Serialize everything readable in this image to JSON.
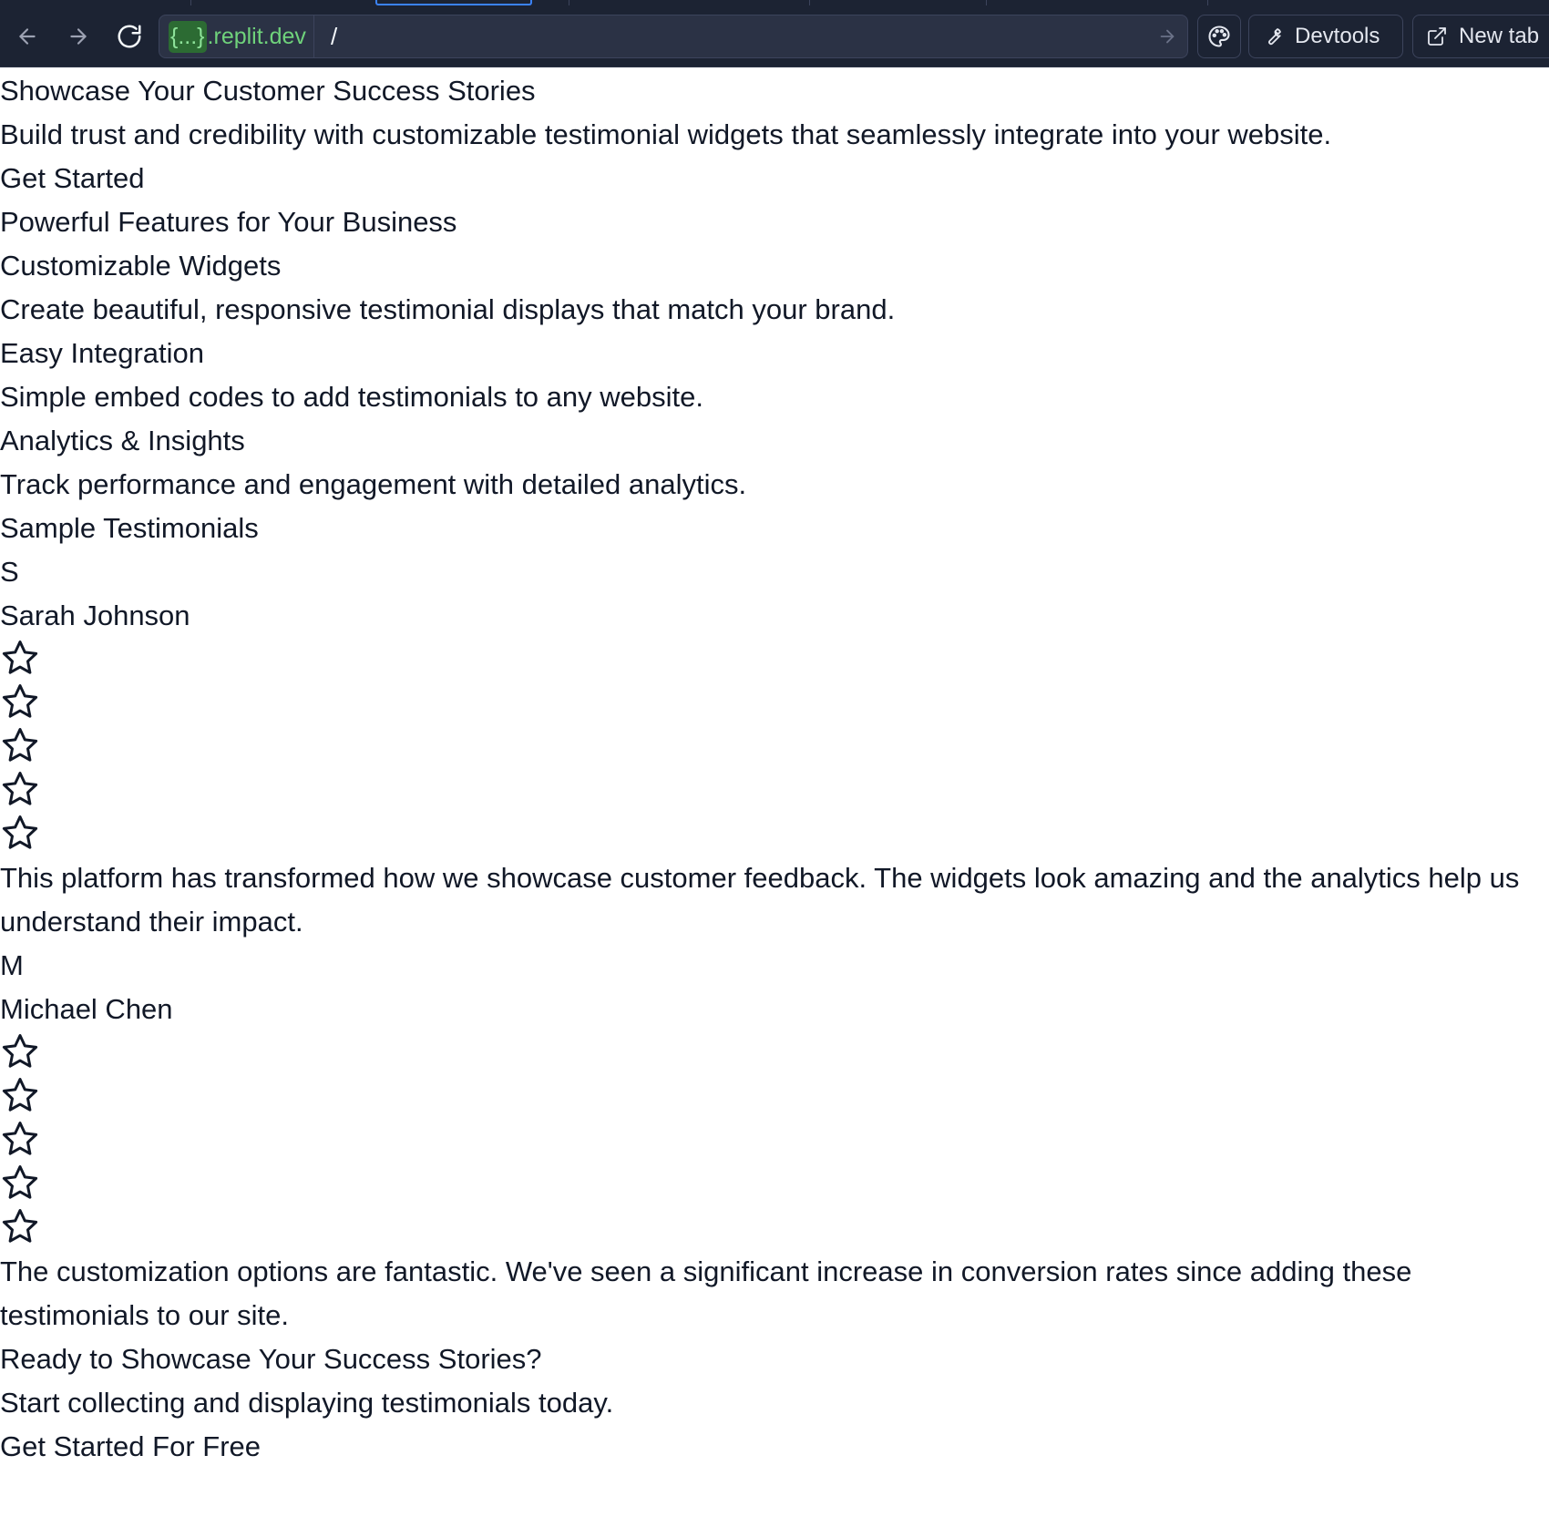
{
  "browser": {
    "url_host_badge": "{...}",
    "url_host_suffix": ".replit.dev",
    "url_path": "/",
    "devtools_label": "Devtools",
    "new_tab_label": "New tab"
  },
  "hero": {
    "title": "Showcase Your Customer Success Stories",
    "subtitle": "Build trust and credibility with customizable testimonial widgets that seamlessly integrate into your website.",
    "cta": "Get Started"
  },
  "features": {
    "heading": "Powerful Features for Your Business",
    "items": [
      {
        "title": "Customizable Widgets",
        "description": "Create beautiful, responsive testimonial displays that match your brand."
      },
      {
        "title": "Easy Integration",
        "description": "Simple embed codes to add testimonials to any website."
      },
      {
        "title": "Analytics & Insights",
        "description": "Track performance and engagement with detailed analytics."
      }
    ]
  },
  "testimonials": {
    "heading": "Sample Testimonials",
    "items": [
      {
        "initial": "S",
        "name": "Sarah Johnson",
        "rating_stars_shown": 5,
        "quote": "This platform has transformed how we showcase customer feedback. The widgets look amazing and the analytics help us understand their impact."
      },
      {
        "initial": "M",
        "name": "Michael Chen",
        "rating_stars_shown": 5,
        "quote": "The customization options are fantastic. We've seen a significant increase in conversion rates since adding these testimonials to our site."
      }
    ]
  },
  "cta_section": {
    "heading": "Ready to Showcase Your Success Stories?",
    "subtitle": "Start collecting and displaying testimonials today.",
    "button": "Get Started For Free"
  },
  "icons": {
    "back": "arrow-left-icon",
    "forward": "arrow-right-icon",
    "reload": "reload-icon",
    "go": "arrow-right-icon",
    "theme": "palette-icon",
    "devtools": "wrench-icon",
    "new_tab": "external-link-icon",
    "rating": "star-outline-icon"
  },
  "colors": {
    "chrome_bg": "#1c2333",
    "url_host": "#6fd27b",
    "active_tab": "#3b82f6",
    "text": "#111827"
  }
}
